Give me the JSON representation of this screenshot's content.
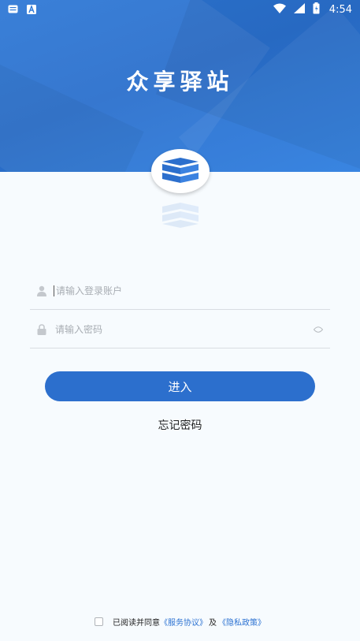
{
  "status_bar": {
    "time": "4:54",
    "left_icons": [
      "message-icon",
      "app-a-icon"
    ],
    "right_icons": [
      "wifi-icon",
      "signal-icon",
      "battery-icon"
    ]
  },
  "header": {
    "title": "众享驿站",
    "background_color": "#2e78d6"
  },
  "logo": {
    "icon": "box-logo-icon"
  },
  "form": {
    "account": {
      "placeholder": "请输入登录账户",
      "value": "",
      "icon": "user-icon"
    },
    "password": {
      "placeholder": "请输入密码",
      "value": "",
      "icon": "lock-icon",
      "toggle_icon": "eye-icon"
    },
    "submit_label": "进入",
    "forgot_label": "忘记密码"
  },
  "agreement": {
    "checked": false,
    "prefix": "已阅读并同意",
    "service_link": "《服务协议》",
    "conjunction": "及",
    "privacy_link": "《隐私政策》"
  },
  "colors": {
    "primary": "#2c6fcd",
    "link": "#2c72d2",
    "page_background": "#f7fbfe"
  }
}
